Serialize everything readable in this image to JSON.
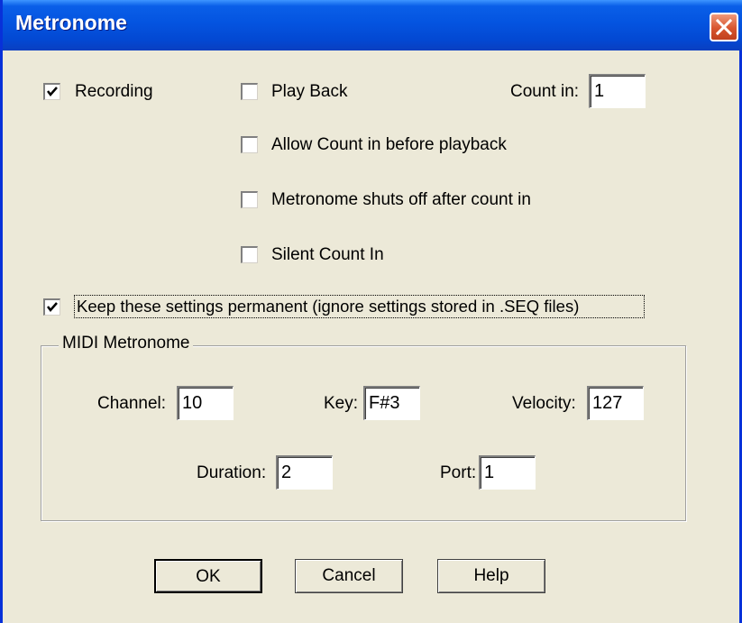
{
  "window": {
    "title": "Metronome"
  },
  "options": {
    "recording": {
      "label": "Recording",
      "checked": true
    },
    "play_back": {
      "label": "Play Back",
      "checked": false
    },
    "count_in_label": "Count in:",
    "count_in_value": "1",
    "allow_count_in": {
      "label": "Allow Count in before playback",
      "checked": false
    },
    "shuts_off": {
      "label": "Metronome shuts off after count in",
      "checked": false
    },
    "silent_count_in": {
      "label": "Silent Count In",
      "checked": false
    },
    "keep_permanent": {
      "label": "Keep these settings permanent (ignore settings stored in .SEQ files)",
      "checked": true
    }
  },
  "midi_metronome": {
    "group_label": "MIDI Metronome",
    "channel_label": "Channel:",
    "channel_value": "10",
    "key_label": "Key:",
    "key_value": "F#3",
    "velocity_label": "Velocity:",
    "velocity_value": "127",
    "duration_label": "Duration:",
    "duration_value": "2",
    "port_label": "Port:",
    "port_value": "1"
  },
  "buttons": {
    "ok": "OK",
    "cancel": "Cancel",
    "help": "Help"
  },
  "icons": {
    "close": "close-icon",
    "check": "checkmark-icon"
  },
  "colors": {
    "titlebar": "#0454e0",
    "dialog_bg": "#ece9d8",
    "close_button": "#d8552f"
  }
}
